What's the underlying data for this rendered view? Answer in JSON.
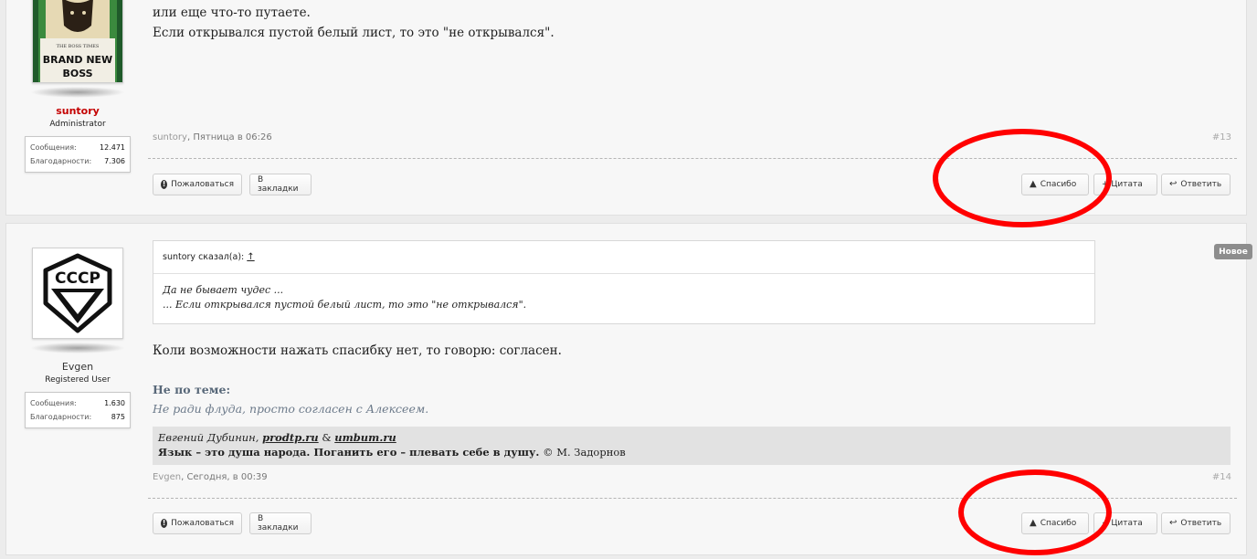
{
  "post1": {
    "text_lines": [
      "или еще что-то путаете.",
      "Если открывался пустой белый лист, то это \"не открывался\"."
    ],
    "user": {
      "name": "suntory",
      "title": "Administrator",
      "stats": [
        {
          "label": "Сообщения:",
          "value": "12.471"
        },
        {
          "label": "Благодарности:",
          "value": "7.306"
        }
      ]
    },
    "avatar_text": [
      "THE BOSS TIMES",
      "BRAND NEW",
      "BOSS"
    ],
    "meta": {
      "author": "suntory",
      "date": "Пятница в 06:26",
      "permalink": "#13"
    }
  },
  "post2": {
    "quote": {
      "author": "suntory сказал(а):",
      "arrow": "↑",
      "lines": [
        "Да не бывает чудес ...",
        "... Если открывался пустой белый лист, то это \"не открывался\"."
      ]
    },
    "text": "Коли возможности нажать спасибку нет, то говорю: согласен.",
    "offtopic": {
      "heading": "Не по теме:",
      "text": "Не ради флуда, просто согласен с Алексеем."
    },
    "signature": {
      "name": "Евгений Дубинин,",
      "link1": "prodtp.ru",
      "amp": "&",
      "link2": "umbum.ru",
      "quote": "Язык – это душа народа. Поганить его – плевать себе в душу.",
      "cite": "© М. Задорнов"
    },
    "user": {
      "name": "Evgen",
      "title": "Registered User",
      "stats": [
        {
          "label": "Сообщения:",
          "value": "1.630"
        },
        {
          "label": "Благодарности:",
          "value": "875"
        }
      ]
    },
    "avatar_text": "СССР",
    "meta": {
      "author": "Evgen",
      "date": "Сегодня, в 00:39",
      "permalink": "#14"
    }
  },
  "buttons": {
    "report": "Пожаловаться",
    "bookmark": "В закладки",
    "thanks": "Спасибо",
    "quote": "+ Цитата",
    "reply": "Ответить"
  },
  "new_badge": "Новое",
  "icons": {
    "report": "warning-icon",
    "thanks": "thumbs-up-icon",
    "reply": "reply-arrow-icon"
  },
  "colors": {
    "admin_name": "#c40000",
    "annotation": "#ff0000",
    "badge": "#8d8d8d"
  }
}
